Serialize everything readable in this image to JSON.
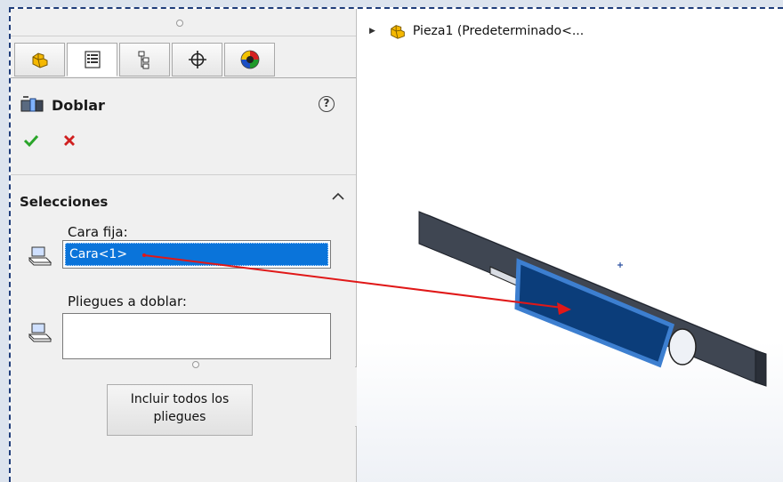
{
  "panel": {
    "tabs": [
      {
        "name": "feature-manager-tab",
        "icon": "part-icon"
      },
      {
        "name": "property-manager-tab",
        "icon": "property-list-icon"
      },
      {
        "name": "configuration-manager-tab",
        "icon": "configuration-icon"
      },
      {
        "name": "dimxpert-manager-tab",
        "icon": "crosshair-icon"
      },
      {
        "name": "display-manager-tab",
        "icon": "appearance-sphere-icon"
      }
    ],
    "title": "Doblar",
    "help_symbol": "?",
    "section": {
      "title": "Selecciones",
      "fixed_face_label": "Cara fija:",
      "fixed_face_value": "Cara<1>",
      "bends_label": "Pliegues a doblar:",
      "bends_value": "",
      "include_button_line1": "Incluir todos los",
      "include_button_line2": "pliegues"
    }
  },
  "viewport": {
    "tree_item": "Pieza1  (Predeterminado<..."
  },
  "colors": {
    "frame_dash": "#1f3d7a",
    "selection_highlight": "#0a74da",
    "ok_check": "#2aa52a",
    "cancel_x": "#d01f1f",
    "arrow": "#e01818",
    "part_body": "#3f4652",
    "selected_face": "#0b3d7a"
  }
}
